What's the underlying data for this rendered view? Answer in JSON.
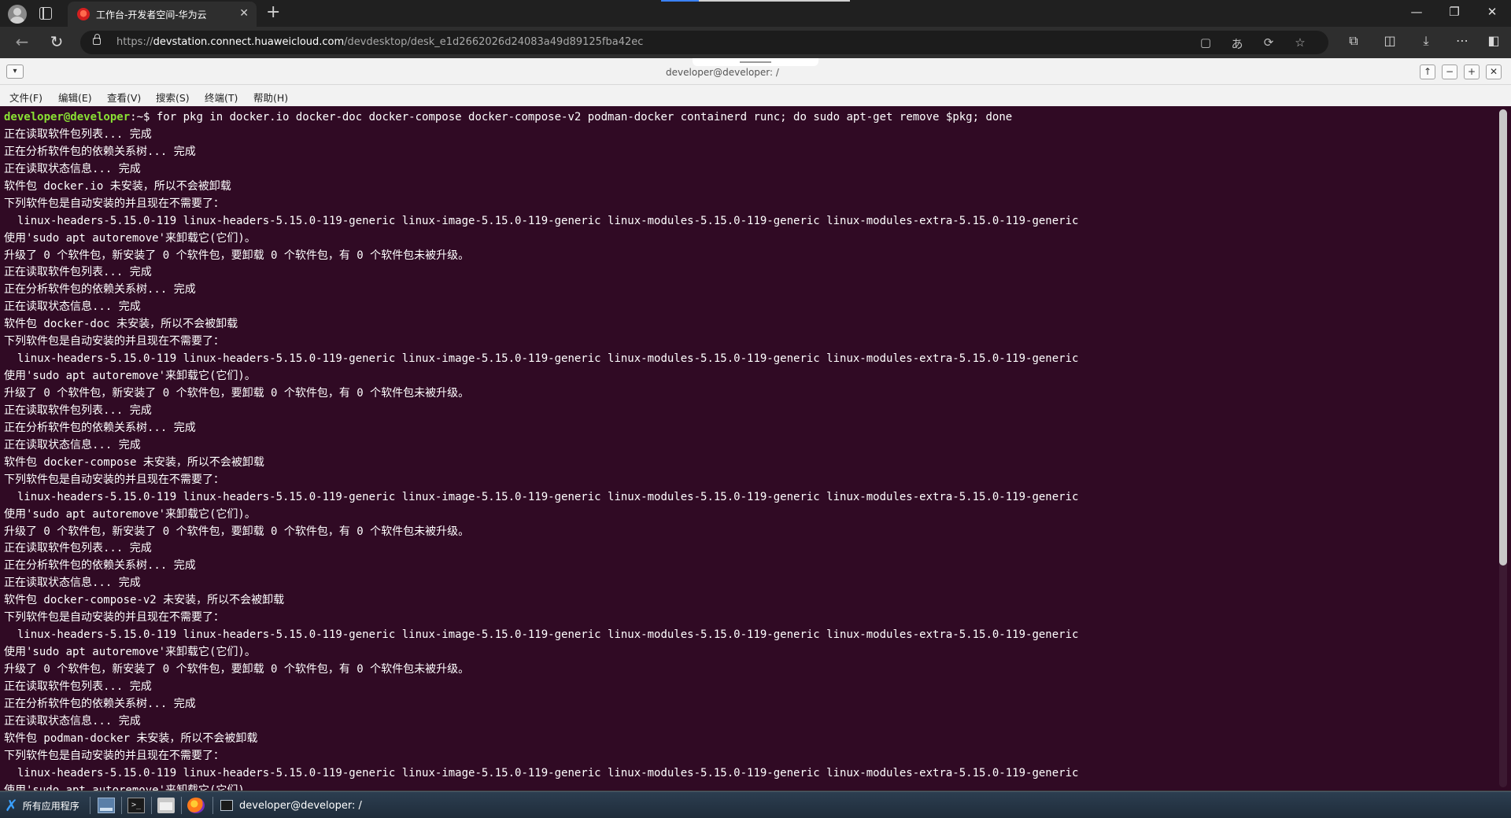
{
  "browser": {
    "tab_title": "工作台-开发者空间-华为云",
    "close_tab_symbol": "✕",
    "new_tab_symbol": "+",
    "url_prefix": "https://",
    "url_host": "devstation.connect.huaweicloud.com",
    "url_path": "/devdesktop/desk_e1d2662026d24083a49d89125fba42ec",
    "icons": [
      "profile-avatar-icon",
      "tab-actions-icon",
      "back-icon",
      "refresh-icon",
      "lock-icon",
      "reader-view-icon",
      "translate-icon",
      "refresh-page-icon",
      "favorite-star-icon",
      "extensions-icon",
      "split-screen-icon",
      "download-icon",
      "more-icon",
      "sidebar-icon"
    ]
  },
  "terminal_window": {
    "title": "developer@developer: /",
    "menu": [
      "文件(F)",
      "编辑(E)",
      "查看(V)",
      "搜索(S)",
      "终端(T)",
      "帮助(H)"
    ]
  },
  "terminal": {
    "background": "#300a24",
    "prompt_color": "#8ae234",
    "prompt_user": "developer@developer",
    "prompt_suffix": ":~$ ",
    "command": "for pkg in docker.io docker-doc docker-compose docker-compose-v2 podman-docker containerd runc; do sudo apt-get remove $pkg; done",
    "lines": [
      "正在读取软件包列表... 完成",
      "正在分析软件包的依赖关系树... 完成",
      "正在读取状态信息... 完成",
      "软件包 docker.io 未安装，所以不会被卸载",
      "下列软件包是自动安装的并且现在不需要了：",
      "  linux-headers-5.15.0-119 linux-headers-5.15.0-119-generic linux-image-5.15.0-119-generic linux-modules-5.15.0-119-generic linux-modules-extra-5.15.0-119-generic",
      "使用'sudo apt autoremove'来卸载它(它们)。",
      "升级了 0 个软件包，新安装了 0 个软件包，要卸载 0 个软件包，有 0 个软件包未被升级。",
      "正在读取软件包列表... 完成",
      "正在分析软件包的依赖关系树... 完成",
      "正在读取状态信息... 完成",
      "软件包 docker-doc 未安装，所以不会被卸载",
      "下列软件包是自动安装的并且现在不需要了：",
      "  linux-headers-5.15.0-119 linux-headers-5.15.0-119-generic linux-image-5.15.0-119-generic linux-modules-5.15.0-119-generic linux-modules-extra-5.15.0-119-generic",
      "使用'sudo apt autoremove'来卸载它(它们)。",
      "升级了 0 个软件包，新安装了 0 个软件包，要卸载 0 个软件包，有 0 个软件包未被升级。",
      "正在读取软件包列表... 完成",
      "正在分析软件包的依赖关系树... 完成",
      "正在读取状态信息... 完成",
      "软件包 docker-compose 未安装，所以不会被卸载",
      "下列软件包是自动安装的并且现在不需要了：",
      "  linux-headers-5.15.0-119 linux-headers-5.15.0-119-generic linux-image-5.15.0-119-generic linux-modules-5.15.0-119-generic linux-modules-extra-5.15.0-119-generic",
      "使用'sudo apt autoremove'来卸载它(它们)。",
      "升级了 0 个软件包，新安装了 0 个软件包，要卸载 0 个软件包，有 0 个软件包未被升级。",
      "正在读取软件包列表... 完成",
      "正在分析软件包的依赖关系树... 完成",
      "正在读取状态信息... 完成",
      "软件包 docker-compose-v2 未安装，所以不会被卸载",
      "下列软件包是自动安装的并且现在不需要了：",
      "  linux-headers-5.15.0-119 linux-headers-5.15.0-119-generic linux-image-5.15.0-119-generic linux-modules-5.15.0-119-generic linux-modules-extra-5.15.0-119-generic",
      "使用'sudo apt autoremove'来卸载它(它们)。",
      "升级了 0 个软件包，新安装了 0 个软件包，要卸载 0 个软件包，有 0 个软件包未被升级。",
      "正在读取软件包列表... 完成",
      "正在分析软件包的依赖关系树... 完成",
      "正在读取状态信息... 完成",
      "软件包 podman-docker 未安装，所以不会被卸载",
      "下列软件包是自动安装的并且现在不需要了：",
      "  linux-headers-5.15.0-119 linux-headers-5.15.0-119-generic linux-image-5.15.0-119-generic linux-modules-5.15.0-119-generic linux-modules-extra-5.15.0-119-generic",
      "使用'sudo apt autoremove'来卸载它(它们)。"
    ]
  },
  "taskbar": {
    "start_label": "所有应用程序",
    "task_label": "developer@developer: /",
    "icons": [
      "show-desktop-icon",
      "terminal-icon",
      "file-manager-icon",
      "firefox-icon"
    ]
  }
}
